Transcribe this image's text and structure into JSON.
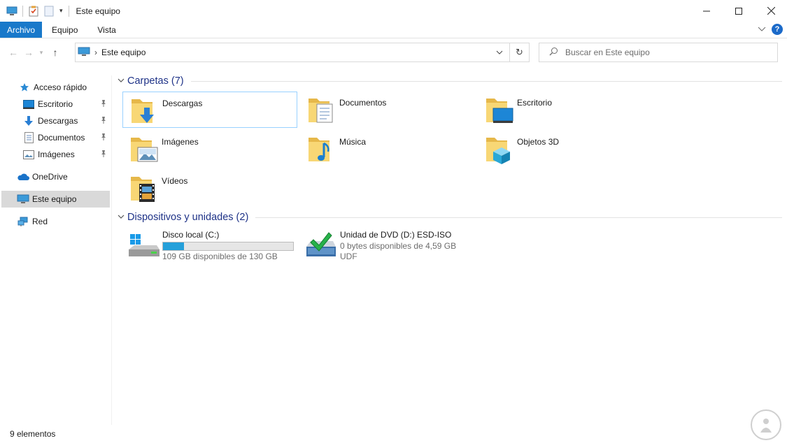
{
  "window": {
    "title": "Este equipo",
    "controls": [
      "minimize-icon",
      "maximize-icon",
      "close-icon"
    ]
  },
  "ribbon": {
    "tabs": [
      "Archivo",
      "Equipo",
      "Vista"
    ]
  },
  "address": {
    "path": "Este equipo"
  },
  "search": {
    "placeholder": "Buscar en Este equipo"
  },
  "sidebar": {
    "items": [
      {
        "label": "Acceso rápido",
        "icon": "star-icon"
      },
      {
        "label": "Escritorio",
        "icon": "desktop-icon",
        "pinned": true
      },
      {
        "label": "Descargas",
        "icon": "download-arrow-icon",
        "pinned": true
      },
      {
        "label": "Documentos",
        "icon": "document-icon",
        "pinned": true
      },
      {
        "label": "Imágenes",
        "icon": "image-icon",
        "pinned": true
      },
      {
        "label": "OneDrive",
        "icon": "cloud-icon"
      },
      {
        "label": "Este equipo",
        "icon": "computer-icon",
        "selected": true
      },
      {
        "label": "Red",
        "icon": "network-icon"
      }
    ]
  },
  "folders": {
    "title": "Carpetas (7)",
    "items": [
      {
        "label": "Descargas",
        "icon": "downloads-folder-icon"
      },
      {
        "label": "Documentos",
        "icon": "documents-folder-icon"
      },
      {
        "label": "Escritorio",
        "icon": "desktop-folder-icon"
      },
      {
        "label": "Imágenes",
        "icon": "pictures-folder-icon"
      },
      {
        "label": "Música",
        "icon": "music-folder-icon"
      },
      {
        "label": "Objetos 3D",
        "icon": "3d-objects-folder-icon"
      },
      {
        "label": "Vídeos",
        "icon": "videos-folder-icon"
      }
    ]
  },
  "devices": {
    "title": "Dispositivos y unidades (2)",
    "items": [
      {
        "name": "Disco local (C:)",
        "detail": "109 GB disponibles de 130 GB",
        "used_fraction": 0.16,
        "icon": "hard-drive-icon"
      },
      {
        "name": "Unidad de DVD (D:) ESD-ISO",
        "detail": "0 bytes disponibles de 4,59 GB",
        "filesystem": "UDF",
        "icon": "dvd-drive-icon"
      }
    ]
  },
  "status": {
    "count": "9 elementos"
  },
  "colors": {
    "accent": "#1979ca",
    "group_title": "#1e3287",
    "selected_nav": "#d9d9d9",
    "drive_bar": "#26a0da",
    "folder_yellow": "#f8d775"
  }
}
